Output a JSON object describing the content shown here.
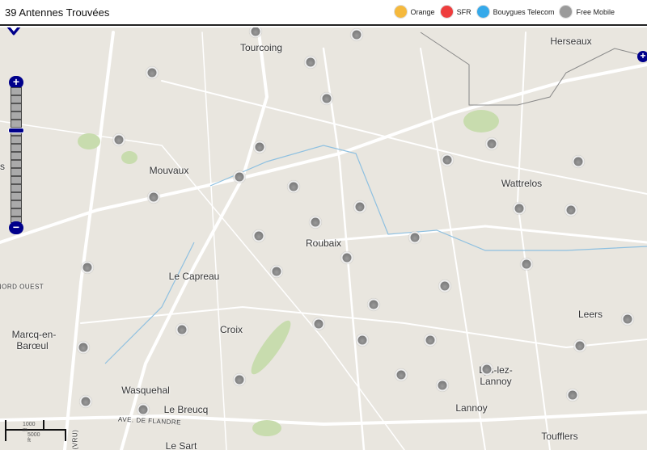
{
  "header": {
    "title": "39 Antennes Trouvées"
  },
  "legend": [
    {
      "label": "Orange",
      "color": "#f5b93d"
    },
    {
      "label": "SFR",
      "color": "#ee3d3d"
    },
    {
      "label": "Bouygues Telecom",
      "color": "#35a9ea"
    },
    {
      "label": "Free Mobile",
      "color": "#9a9a9a"
    }
  ],
  "map": {
    "labels": [
      "Tourcoing",
      "Herseaux",
      "Mouvaux",
      "Wattrelos",
      "Roubaix",
      "Le Capreau",
      "Croix",
      "Leers",
      "Marcq-en-",
      "Barœul",
      "Wasquehal",
      "Le Breucq",
      "Lannoy",
      "Lys-lez-",
      "Lannoy",
      "Toufflers",
      "Le Sart",
      "NORD OUEST",
      "AVE. DE FLANDRE",
      "(VRU)",
      "s"
    ],
    "scale": {
      "metric": "1000 m",
      "imperial": "5000 ft"
    },
    "marker_count": 39,
    "marker_operator": "Free Mobile"
  },
  "controls": {
    "zoom_in": "+",
    "zoom_out": "−",
    "pan_east": "+"
  }
}
